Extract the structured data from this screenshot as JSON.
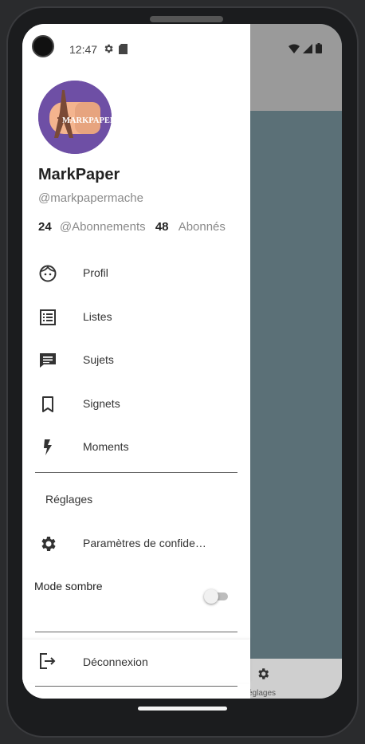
{
  "status_bar": {
    "time": "12:47"
  },
  "profile": {
    "logo_text": "MARKPAPER",
    "name": "MarkPaper",
    "handle": "@markpapermache",
    "following_count": "24",
    "following_label": "@Abonnements",
    "followers_count": "48",
    "followers_label": "Abonnés"
  },
  "menu": {
    "items": [
      {
        "label": "Profil",
        "icon": "face-icon"
      },
      {
        "label": "Listes",
        "icon": "list-icon"
      },
      {
        "label": "Sujets",
        "icon": "comment-icon"
      },
      {
        "label": "Signets",
        "icon": "bookmark-icon"
      },
      {
        "label": "Moments",
        "icon": "bolt-icon"
      }
    ],
    "settings_section": "Réglages",
    "privacy": "Paramètres de confide…",
    "dark_mode": "Mode sombre",
    "dark_mode_on": false,
    "logout": "Déconnexion"
  },
  "background": {
    "bottom_tab_label": "églages"
  },
  "colors": {
    "avatar_bg": "#6e4fa5",
    "content_bg": "#5b7077"
  }
}
